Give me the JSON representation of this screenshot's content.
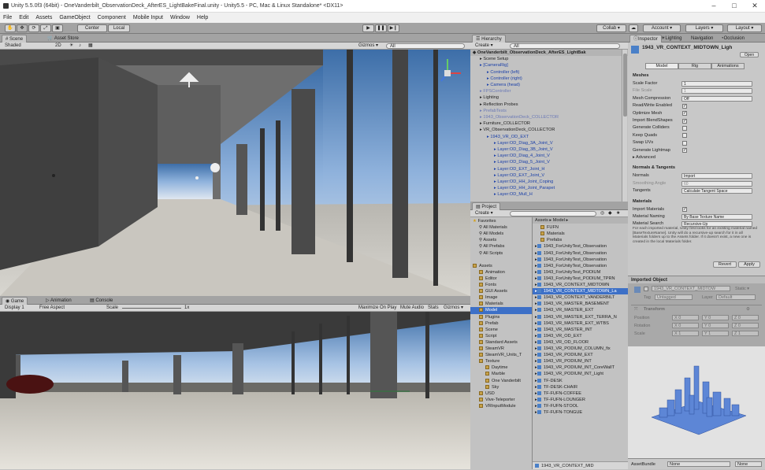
{
  "window": {
    "title": "Unity 5.5.0f3 (64bit) - OneVanderbilt_ObservationDeck_AfterES_LightBakeFinal.unity - Unity5.5 - PC, Mac & Linux Standalone* <DX11>",
    "min": "–",
    "max": "□",
    "close": "✕"
  },
  "menu": [
    "File",
    "Edit",
    "Assets",
    "GameObject",
    "Component",
    "Mobile Input",
    "Window",
    "Help"
  ],
  "toolbar": {
    "pivot": "Center",
    "space": "Local",
    "collab": "Collab ▾",
    "account": "Account ▾",
    "layers": "Layers ▾",
    "layout": "Layout ▾"
  },
  "scene": {
    "tab_scene": "Scene",
    "tab_asset": "Asset Store",
    "shading": "Shaded",
    "mode2d": "2D",
    "gizmos": "Gizmos ▾",
    "search": "All"
  },
  "game": {
    "tab_game": "Game",
    "tab_anim": "Animation",
    "tab_console": "Console",
    "display": "Display 1",
    "aspect": "Free Aspect",
    "scale_label": "Scale",
    "scale_val": "1x",
    "maximize": "Maximize On Play",
    "mute": "Mute Audio",
    "stats": "Stats",
    "gizmos": "Gizmos ▾"
  },
  "hierarchy": {
    "tab": "Hierarchy",
    "create": "Create ▾",
    "search": "All",
    "root": "OneVanderbilt_ObservationDeck_AfterES_LightBak",
    "items": [
      {
        "t": "Scene Setup",
        "i": 1,
        "c": ""
      },
      {
        "t": "[CameraRig]",
        "i": 1,
        "c": "blue"
      },
      {
        "t": "Controller (left)",
        "i": 2,
        "c": "blue"
      },
      {
        "t": "Controller (right)",
        "i": 2,
        "c": "blue"
      },
      {
        "t": "Camera (head)",
        "i": 2,
        "c": "blue"
      },
      {
        "t": "FPSController",
        "i": 1,
        "c": "dim"
      },
      {
        "t": "Lighting",
        "i": 1,
        "c": ""
      },
      {
        "t": "Reflection Probes",
        "i": 1,
        "c": ""
      },
      {
        "t": "PrefabTests",
        "i": 1,
        "c": "dim"
      },
      {
        "t": "1943_ObservationDeck_COLLECTOR",
        "i": 1,
        "c": "dim"
      },
      {
        "t": "Furniture_COLLECTOR",
        "i": 1,
        "c": ""
      },
      {
        "t": "VR_ObservationDeck_COLLECTOR",
        "i": 1,
        "c": ""
      },
      {
        "t": "1943_VR_OD_EXT",
        "i": 2,
        "c": "blue"
      },
      {
        "t": "Layer:OD_Diag_3A_Joint_V",
        "i": 3,
        "c": "blue"
      },
      {
        "t": "Layer:OD_Diag_3B_Joint_V",
        "i": 3,
        "c": "blue"
      },
      {
        "t": "Layer:OD_Diag_4_Joint_V",
        "i": 3,
        "c": "blue"
      },
      {
        "t": "Layer:OD_Diag_5_Joint_V",
        "i": 3,
        "c": "blue"
      },
      {
        "t": "Layer:OD_EXT_Joint_H",
        "i": 3,
        "c": "blue"
      },
      {
        "t": "Layer:OD_EXT_Joint_V",
        "i": 3,
        "c": "blue"
      },
      {
        "t": "Layer:OD_HH_Joint_Coping",
        "i": 3,
        "c": "blue"
      },
      {
        "t": "Layer:OD_HH_Joint_Parapet",
        "i": 3,
        "c": "blue"
      },
      {
        "t": "Layer:OD_Mull_H",
        "i": 3,
        "c": "blue"
      }
    ]
  },
  "project": {
    "tab": "Project",
    "create": "Create ▾",
    "breadcrumb": "Assets ▸ Model ▸",
    "tree": [
      {
        "t": "Favorites",
        "i": 0,
        "k": "star"
      },
      {
        "t": "All Materials",
        "i": 1,
        "k": "search"
      },
      {
        "t": "All Models",
        "i": 1,
        "k": "search"
      },
      {
        "t": "Assets",
        "i": 1,
        "k": "search"
      },
      {
        "t": "All Prefabs",
        "i": 1,
        "k": "search"
      },
      {
        "t": "All Scripts",
        "i": 1,
        "k": "search"
      },
      {
        "t": "",
        "i": 0,
        "k": "gap"
      },
      {
        "t": "Assets",
        "i": 0,
        "k": "fold"
      },
      {
        "t": "Animation",
        "i": 1,
        "k": "fold"
      },
      {
        "t": "Editor",
        "i": 1,
        "k": "fold"
      },
      {
        "t": "Fonts",
        "i": 1,
        "k": "fold"
      },
      {
        "t": "GUI Assets",
        "i": 1,
        "k": "fold"
      },
      {
        "t": "Image",
        "i": 1,
        "k": "fold"
      },
      {
        "t": "Materials",
        "i": 1,
        "k": "fold"
      },
      {
        "t": "Model",
        "i": 1,
        "k": "fold",
        "sel": true
      },
      {
        "t": "Plugins",
        "i": 1,
        "k": "fold"
      },
      {
        "t": "Prefab",
        "i": 1,
        "k": "fold"
      },
      {
        "t": "Scene",
        "i": 1,
        "k": "fold"
      },
      {
        "t": "Script",
        "i": 1,
        "k": "fold"
      },
      {
        "t": "Standard Assets",
        "i": 1,
        "k": "fold"
      },
      {
        "t": "SteamVR",
        "i": 1,
        "k": "fold"
      },
      {
        "t": "SteamVR_Units_T",
        "i": 1,
        "k": "fold"
      },
      {
        "t": "Texture",
        "i": 1,
        "k": "fold"
      },
      {
        "t": "Daytime",
        "i": 2,
        "k": "fold"
      },
      {
        "t": "Marble",
        "i": 2,
        "k": "fold"
      },
      {
        "t": "One Vanderbilt",
        "i": 2,
        "k": "fold"
      },
      {
        "t": "Sky",
        "i": 2,
        "k": "fold"
      },
      {
        "t": "USD",
        "i": 1,
        "k": "fold"
      },
      {
        "t": "Vive-Teleporter",
        "i": 1,
        "k": "fold"
      },
      {
        "t": "VRInputModule",
        "i": 1,
        "k": "fold"
      }
    ],
    "files": [
      {
        "t": "FUFN",
        "k": "fold"
      },
      {
        "t": "Materials",
        "k": "fold"
      },
      {
        "t": "Prefabs",
        "k": "fold"
      },
      {
        "t": "1943_ForUnityTest_Observation",
        "k": "cube"
      },
      {
        "t": "1943_ForUnityTest_Observation",
        "k": "cube"
      },
      {
        "t": "1943_ForUnityTest_Observation",
        "k": "cube"
      },
      {
        "t": "1943_ForUnityTest_Observation",
        "k": "cube"
      },
      {
        "t": "1943_ForUnityTest_PODIUM",
        "k": "cube"
      },
      {
        "t": "1943_ForUnityTest_PODIUM_TPRN",
        "k": "cube"
      },
      {
        "t": "1943_VR_CONTEXT_MIDTOWN",
        "k": "cube"
      },
      {
        "t": "1943_VR_CONTEXT_MIDTOWN_La",
        "k": "cube",
        "sel": true
      },
      {
        "t": "1943_VR_CONTEXT_VANDERBILT",
        "k": "cube"
      },
      {
        "t": "1943_VR_MASTER_BASEMENT",
        "k": "cube"
      },
      {
        "t": "1943_VR_MASTER_EXT",
        "k": "cube"
      },
      {
        "t": "1943_VR_MASTER_EXT_TERRA_N",
        "k": "cube"
      },
      {
        "t": "1943_VR_MASTER_EXT_WTBS",
        "k": "cube"
      },
      {
        "t": "1943_VR_MASTER_INT",
        "k": "cube"
      },
      {
        "t": "1943_VR_OD_EXT",
        "k": "cube"
      },
      {
        "t": "1943_VR_OD_FLOOR",
        "k": "cube"
      },
      {
        "t": "1943_VR_PODIUM_COLUMN_fix",
        "k": "cube"
      },
      {
        "t": "1943_VR_PODIUM_EXT",
        "k": "cube"
      },
      {
        "t": "1943_VR_PODIUM_INT",
        "k": "cube"
      },
      {
        "t": "1943_VR_PODIUM_INT_CoreWallT",
        "k": "cube"
      },
      {
        "t": "1943_VR_PODIUM_INT_Light",
        "k": "cube"
      },
      {
        "t": "TF-DESK",
        "k": "cube"
      },
      {
        "t": "TF-DESK-CHAIR",
        "k": "cube"
      },
      {
        "t": "TF-FUFN-COFFEE",
        "k": "cube"
      },
      {
        "t": "TF-FUFN-LOUNGER",
        "k": "cube"
      },
      {
        "t": "TF-FUFN-STOOL",
        "k": "cube"
      },
      {
        "t": "TF-FUFN-TONGUE",
        "k": "cube"
      }
    ],
    "footer": "1943_VR_CONTEXT_MID"
  },
  "inspector": {
    "tab": "Inspector",
    "tab2": "Lighting",
    "tab3": "Navigation",
    "tab4": "Occlusion",
    "title": "1943_VR_CONTEXT_MIDTOWN_Ligh",
    "open": "Open",
    "subtabs": [
      "Model",
      "Rig",
      "Animations"
    ],
    "meshes_header": "Meshes",
    "rows": [
      {
        "l": "Scale Factor",
        "v": "1",
        "k": "val"
      },
      {
        "l": "File Scale",
        "v": "1",
        "k": "val",
        "dim": true
      },
      {
        "l": "Mesh Compression",
        "v": "Off",
        "k": "val"
      },
      {
        "l": "Read/Write Enabled",
        "v": "✓",
        "k": "chk"
      },
      {
        "l": "Optimize Mesh",
        "v": "✓",
        "k": "chk"
      },
      {
        "l": "Import BlendShapes",
        "v": "✓",
        "k": "chk"
      },
      {
        "l": "Generate Colliders",
        "v": "",
        "k": "chk"
      },
      {
        "l": "Keep Quads",
        "v": "",
        "k": "chk"
      },
      {
        "l": "Swap UVs",
        "v": "",
        "k": "chk"
      },
      {
        "l": "Generate Lightmap",
        "v": "✓",
        "k": "chk"
      },
      {
        "l": "▸ Advanced",
        "v": "",
        "k": "none"
      }
    ],
    "nt_header": "Normals & Tangents",
    "nt_rows": [
      {
        "l": "Normals",
        "v": "Import",
        "k": "val"
      },
      {
        "l": "Smoothing Angle",
        "v": "60",
        "k": "val",
        "dim": true
      },
      {
        "l": "Tangents",
        "v": "Calculate Tangent Space",
        "k": "val"
      }
    ],
    "mat_header": "Materials",
    "mat_rows": [
      {
        "l": "Import Materials",
        "v": "✓",
        "k": "chk"
      },
      {
        "l": "Material Naming",
        "v": "By Base Texture Name",
        "k": "val"
      },
      {
        "l": "Material Search",
        "v": "Recursive-Up",
        "k": "val"
      }
    ],
    "help": "For each imported material, Unity first looks for an existing material named [BaseTextureName]. Unity will do a recursive-up search for it in all Materials folders up to the Assets folder. If it doesn't exist, a new one is created in the local Materials folder.",
    "revert": "Revert",
    "apply": "Apply",
    "imported_header": "Imported Object",
    "obj_name": "1943_VR_CONTEXT_MIDTOW",
    "static": "Static ▾",
    "tag_label": "Tag",
    "tag_val": "Untagged",
    "layer_label": "Layer",
    "layer_val": "Default",
    "transform": "Transform",
    "t_rows": [
      {
        "l": "Position",
        "x": "X 0",
        "y": "Y 0",
        "z": "Z 0"
      },
      {
        "l": "Rotation",
        "x": "X 0",
        "y": "Y 0",
        "z": "Z 0"
      },
      {
        "l": "Scale",
        "x": "X 1",
        "y": "Y 1",
        "z": "Z 1"
      }
    ],
    "assetbundle": "AssetBundle",
    "ab_val": "None",
    "ab_val2": "None"
  }
}
